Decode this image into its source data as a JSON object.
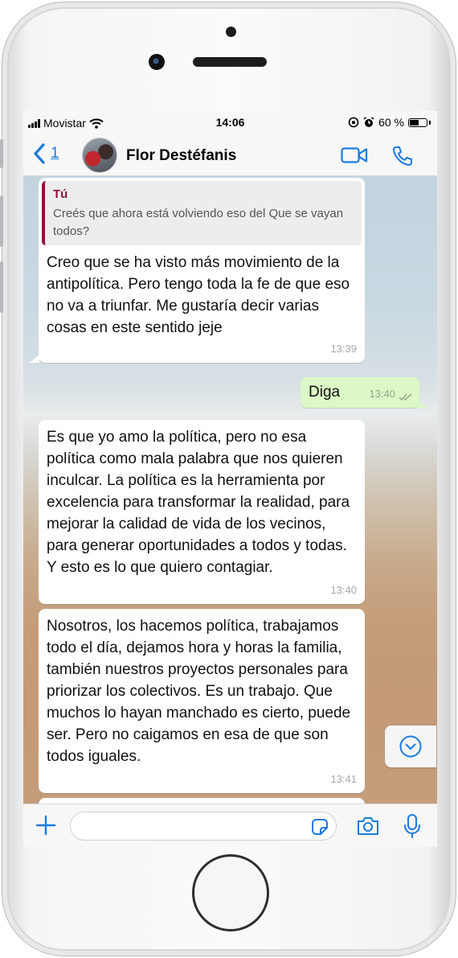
{
  "statusbar": {
    "carrier": "Movistar",
    "time": "14:06",
    "battery": "60 %",
    "battery_level": 0.6
  },
  "header": {
    "back_count": "1",
    "contact_name": "Flor Destéfanis",
    "icons": [
      "chevron-left-icon",
      "video-call-icon",
      "phone-icon"
    ]
  },
  "messages": [
    {
      "direction": "incoming",
      "quote_author": "Tú",
      "quote_text": "Creés que ahora está volviendo eso del Que se vayan todos?",
      "text": "Creo que se ha visto más movimiento de la antipolítica. Pero tengo toda la fe de que eso no va a triunfar. Me gustaría decir varias cosas en este sentido jeje",
      "time": "13:39"
    },
    {
      "direction": "outgoing",
      "text": "Diga",
      "time": "13:40"
    },
    {
      "direction": "incoming",
      "text": "Es que yo amo la política, pero no esa política como mala palabra que nos quieren inculcar. La política es la herramienta por excelencia para transformar la realidad, para mejorar la calidad de vida de los vecinos, para generar oportunidades a todos y todas. Y esto es lo que quiero contagiar.",
      "time": "13:40"
    },
    {
      "direction": "incoming",
      "text": "Nosotros, los hacemos política, trabajamos todo el día, dejamos hora y horas la familia, también nuestros proyectos personales para priorizar los colectivos. Es un trabajo. Que muchos lo hayan manchado es cierto, puede ser. Pero no caigamos en esa de que son todos iguales.",
      "time": "13:41"
    }
  ],
  "colors": {
    "accent": "#1b7be0",
    "outgoing_bubble": "#dcf8c6",
    "incoming_bubble": "#ffffff",
    "quote_bar": "#8a1538"
  },
  "input": {
    "placeholder": "",
    "icons": [
      "plus-icon",
      "sticker-icon",
      "camera-icon",
      "microphone-icon"
    ]
  }
}
